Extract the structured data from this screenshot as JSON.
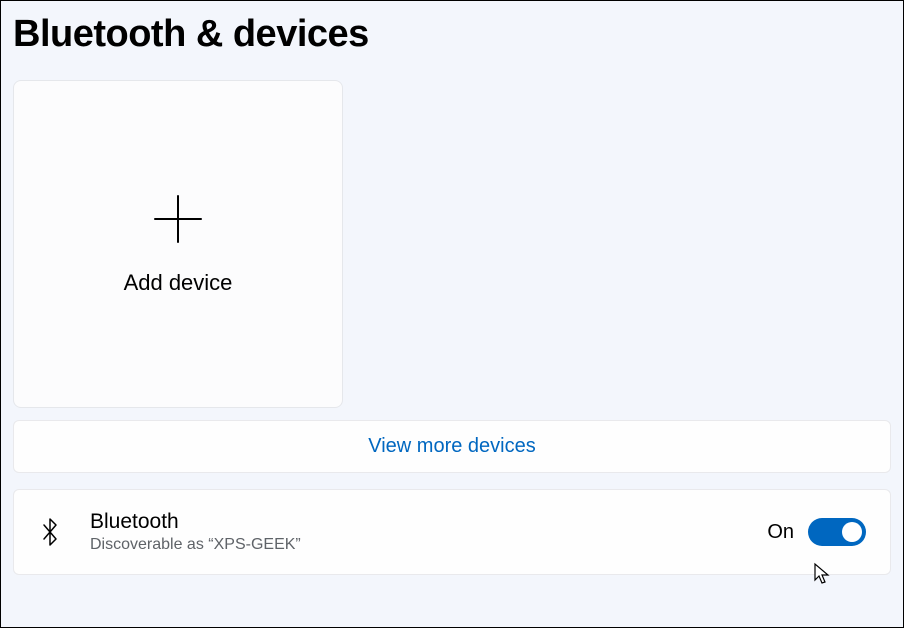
{
  "page": {
    "title": "Bluetooth & devices"
  },
  "add_device": {
    "label": "Add device"
  },
  "view_more": {
    "label": "View more devices"
  },
  "bluetooth": {
    "title": "Bluetooth",
    "subtitle": "Discoverable as “XPS-GEEK”",
    "toggle_state": "On",
    "toggle_enabled": true
  },
  "colors": {
    "accent": "#0067c0",
    "link": "#0067c0",
    "card_bg": "#fcfcfd",
    "page_bg": "#f3f6fc"
  }
}
